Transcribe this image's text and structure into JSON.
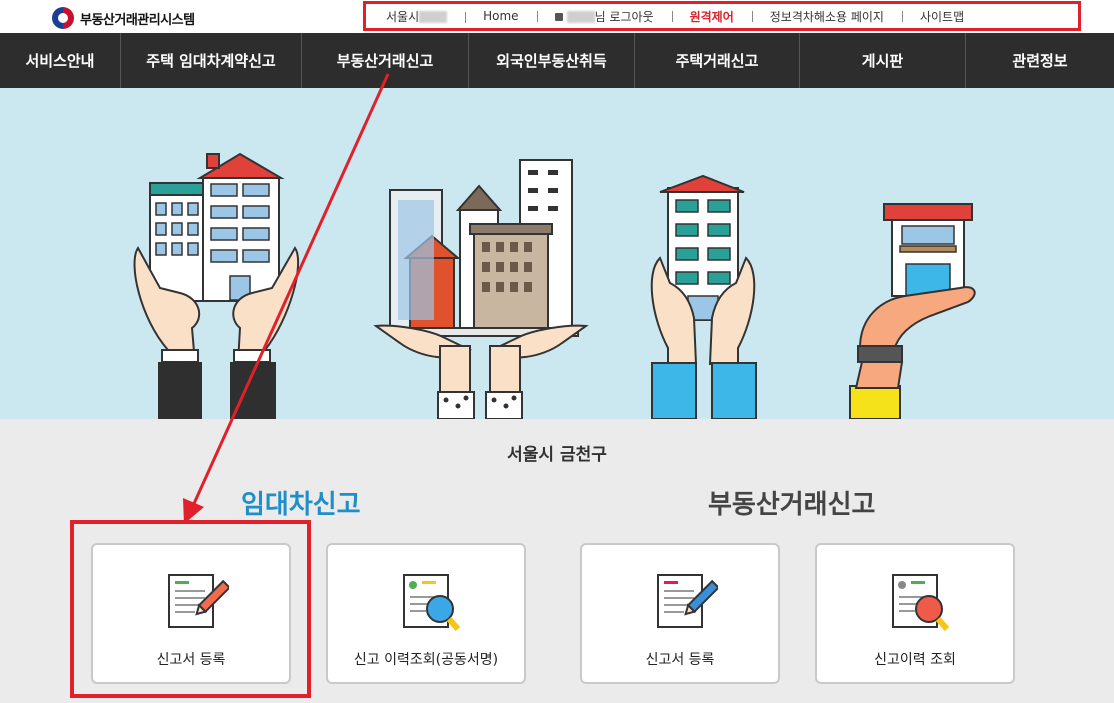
{
  "header": {
    "logo_text": "부동산거래관리시스템",
    "util_links": {
      "region_prefix": "서울시",
      "home": "Home",
      "user_suffix": "님 로그아웃",
      "remote": "원격제어",
      "accessibility": "정보격차해소용 페이지",
      "sitemap": "사이트맵"
    }
  },
  "nav": {
    "items": [
      "서비스안내",
      "주택 임대차계약신고",
      "부동산거래신고",
      "외국인부동산취득",
      "주택거래신고",
      "게시판",
      "관련정보"
    ]
  },
  "main": {
    "region": "서울시 금천구",
    "lease_section": {
      "title": "임대차신고",
      "cards": [
        {
          "label": "신고서 등록",
          "icon": "write-form-icon"
        },
        {
          "label": "신고 이력조회(공동서명)",
          "icon": "search-history-icon"
        }
      ]
    },
    "trade_section": {
      "title": "부동산거래신고",
      "cards": [
        {
          "label": "신고서 등록",
          "icon": "write-form-icon"
        },
        {
          "label": "신고이력 조회",
          "icon": "search-history-icon"
        }
      ]
    }
  },
  "colors": {
    "accent_blue": "#1e8fc8",
    "highlight_red": "#e0202a",
    "nav_bg": "#2d2d2d",
    "hero_bg": "#cbe8f0"
  }
}
